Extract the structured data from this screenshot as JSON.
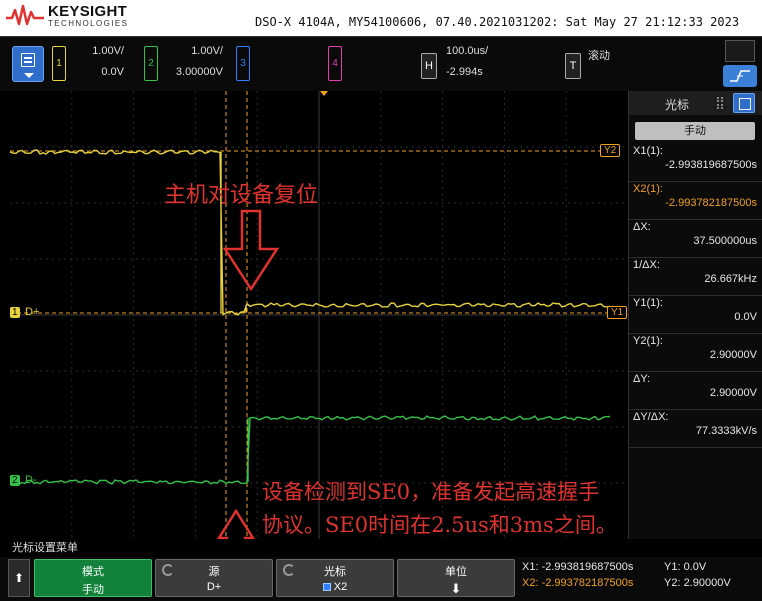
{
  "header": {
    "brand": "KEYSIGHT",
    "brand_sub": "TECHNOLOGIES",
    "model_line": "DSO-X 4104A, MY54100606, 07.40.2021031202: Sat May 27 21:12:33 2023"
  },
  "toolbar": {
    "ch1": {
      "num": "1",
      "scale": "1.00V/",
      "offset": "0.0V",
      "color": "#e6d23c"
    },
    "ch2": {
      "num": "2",
      "scale": "1.00V/",
      "offset": "3.00000V",
      "color": "#35c24a"
    },
    "ch3": {
      "num": "3",
      "color": "#2f7fff"
    },
    "ch4": {
      "num": "4",
      "color": "#e040b0"
    },
    "h_label": "H",
    "timebase": "100.0us/",
    "delay": "-2.994s",
    "t_label": "T",
    "trigger_mode": "滚动"
  },
  "waveform": {
    "annotation_top": "主机对设备复位",
    "annotation_bottom_1": "设备检测到SE0，准备发起高速握手",
    "annotation_bottom_2": "协议。SE0时间在2.5us和3ms之间。",
    "marker_y1": "Y1",
    "marker_y2": "Y2",
    "ch1_tag": "1",
    "ch1_name": "D+",
    "ch2_tag": "2",
    "ch2_name": "D-",
    "x_cursor_tag": "X"
  },
  "cursor_panel": {
    "title": "光标",
    "mode_button": "手动",
    "rows": [
      {
        "key": "X1(1):",
        "value": "-2.993819687500s",
        "color": "#e6e6e6"
      },
      {
        "key": "X2(1):",
        "value": "-2.993782187500s",
        "color": "#f0a020"
      },
      {
        "key": "ΔX:",
        "value": "37.500000us",
        "color": "#e6e6e6"
      },
      {
        "key": "1/ΔX:",
        "value": "26.667kHz",
        "color": "#e6e6e6"
      },
      {
        "key": "Y1(1):",
        "value": "0.0V",
        "color": "#e6e6e6"
      },
      {
        "key": "Y2(1):",
        "value": "2.90000V",
        "color": "#e6e6e6"
      },
      {
        "key": "ΔY:",
        "value": "2.90000V",
        "color": "#e6e6e6"
      },
      {
        "key": "ΔY/ΔX:",
        "value": "77.3333kV/s",
        "color": "#e6e6e6"
      }
    ]
  },
  "softkeys": {
    "menu_title": "光标设置菜单",
    "mode": {
      "label": "模式",
      "value": "手动"
    },
    "source": {
      "label": "源",
      "value": "D+"
    },
    "cursor": {
      "label": "光标",
      "value": "X2"
    },
    "units": {
      "label": "单位"
    },
    "readout": {
      "x1": "X1: -2.993819687500s",
      "x2": "X2: -2.993782187500s",
      "y1": "Y1: 0.0V",
      "y2": "Y2: 2.90000V"
    }
  }
}
